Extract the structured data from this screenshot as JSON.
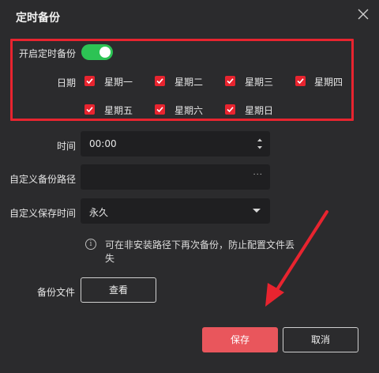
{
  "dialog": {
    "title": "定时备份"
  },
  "schedule": {
    "enable_label": "开启定时备份",
    "enabled": true,
    "date_label": "日期",
    "days": [
      {
        "label": "星期一",
        "checked": true
      },
      {
        "label": "星期二",
        "checked": true
      },
      {
        "label": "星期三",
        "checked": true
      },
      {
        "label": "星期四",
        "checked": true
      },
      {
        "label": "星期五",
        "checked": true
      },
      {
        "label": "星期六",
        "checked": true
      },
      {
        "label": "星期日",
        "checked": true
      }
    ]
  },
  "form": {
    "time_label": "时间",
    "time_value": "00:00",
    "path_label": "自定义备份路径",
    "path_value": "",
    "path_browse": "···",
    "retention_label": "自定义保存时间",
    "retention_value": "永久"
  },
  "notice": {
    "icon": "info-icon",
    "text": "可在非安装路径下再次备份，防止配置文件丢失"
  },
  "backup_file": {
    "label": "备份文件",
    "view_button": "查看"
  },
  "footer": {
    "save": "保存",
    "cancel": "取消"
  },
  "colors": {
    "background": "#2b2b2d",
    "field": "#1f1f21",
    "accent_red": "#e8242f",
    "save_button": "#e9565c",
    "toggle_on": "#2cc354"
  }
}
